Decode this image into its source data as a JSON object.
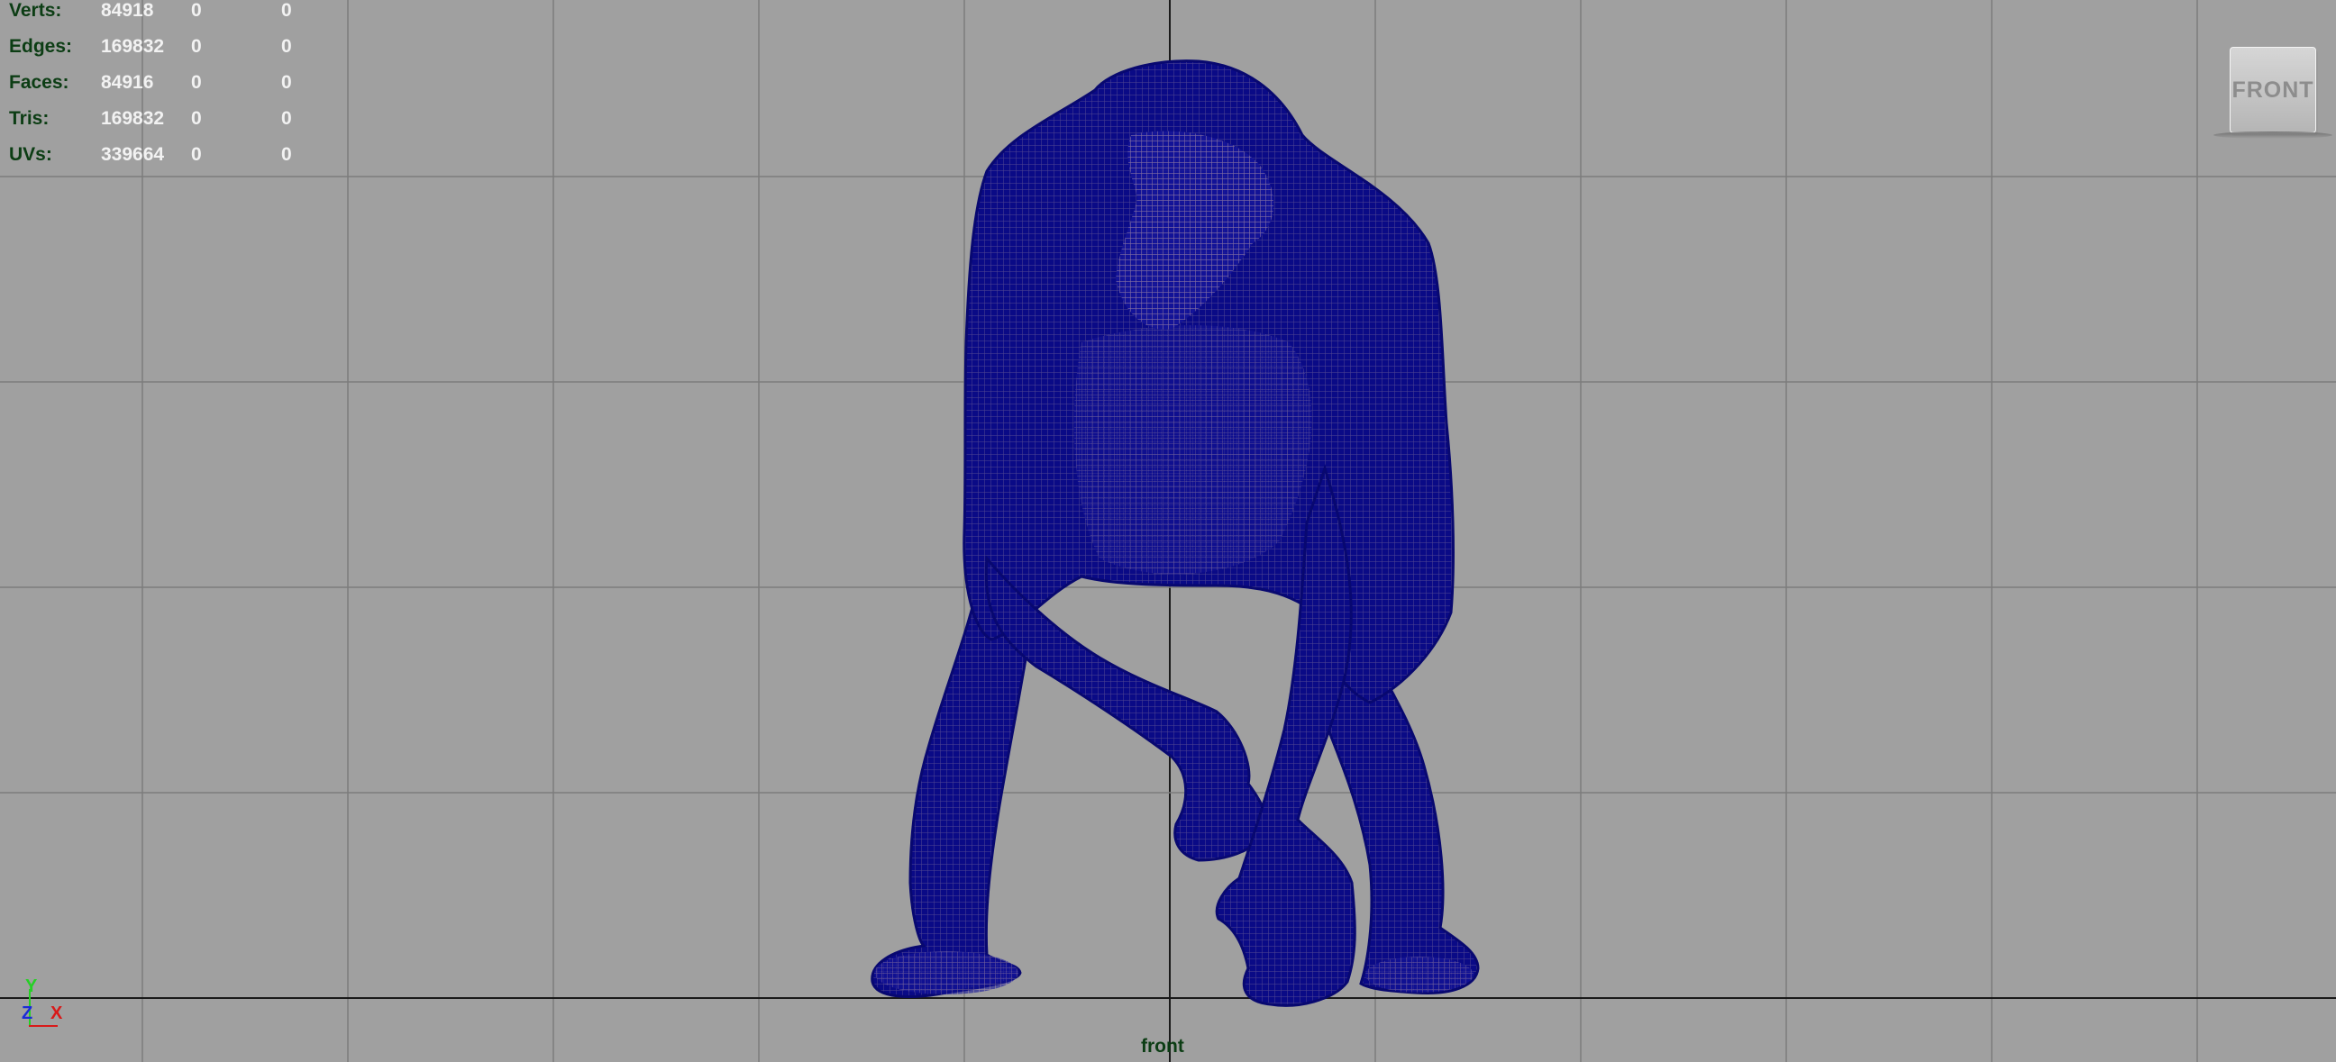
{
  "viewport": {
    "camera_label": "front",
    "viewcube_label": "FRONT",
    "background_color": "#a0a0a0",
    "grid_color": "#7c7c7c",
    "axis_color": "#1a1a1a",
    "mesh_color": "#0c0c8a"
  },
  "hud": {
    "rows": [
      {
        "label": "Verts:",
        "v1": "84918",
        "v2": "0",
        "v3": "0"
      },
      {
        "label": "Edges:",
        "v1": "169832",
        "v2": "0",
        "v3": "0"
      },
      {
        "label": "Faces:",
        "v1": "84916",
        "v2": "0",
        "v3": "0"
      },
      {
        "label": "Tris:",
        "v1": "169832",
        "v2": "0",
        "v3": "0"
      },
      {
        "label": "UVs:",
        "v1": "339664",
        "v2": "0",
        "v3": "0"
      }
    ]
  },
  "axis_gizmo": {
    "y": "Y",
    "z": "Z",
    "x": "X"
  }
}
